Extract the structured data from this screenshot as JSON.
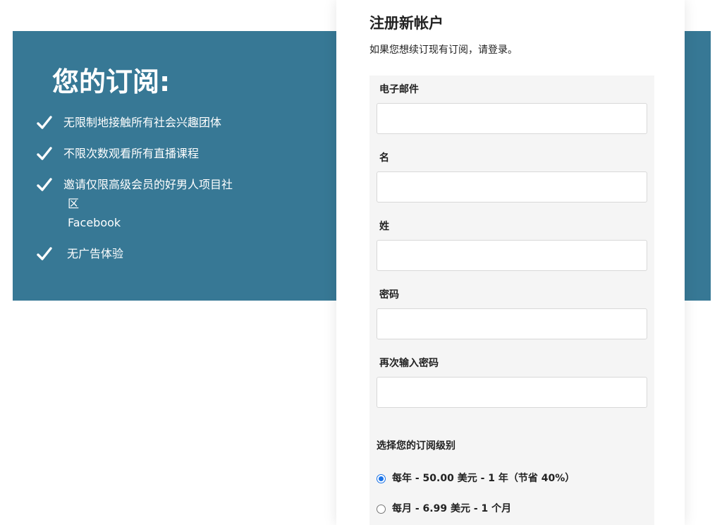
{
  "benefits_panel": {
    "title": "您的订阅:",
    "items": [
      {
        "lines": [
          "无限制地接触所有社会兴趣团体"
        ]
      },
      {
        "lines": [
          "不限次数观看所有直播课程"
        ]
      },
      {
        "lines": [
          "邀请仅限高级会员的好男人项目社",
          "区",
          "Facebook"
        ]
      },
      {
        "lines": [
          "无广告体验"
        ]
      }
    ],
    "icon": "checkmark-icon",
    "background_color": "#377895"
  },
  "signup": {
    "title": "注册新帐户",
    "subtitle": "如果您想续订现有订阅，请登录。",
    "fields": {
      "email_label": "电子邮件",
      "email_value": "",
      "first_name_label": "名",
      "first_name_value": "",
      "last_name_label": "姓",
      "last_name_value": "",
      "password_label": "密码",
      "password_value": "",
      "confirm_password_label": "再次输入密码",
      "confirm_password_value": ""
    },
    "subscription_level": {
      "label": "选择您的订阅级别",
      "options": [
        {
          "label": "每年 - 50.00 美元 - 1 年（节省 40%）",
          "selected": true
        },
        {
          "label": "每月 - 6.99 美元 - 1 个月",
          "selected": false
        }
      ]
    }
  }
}
